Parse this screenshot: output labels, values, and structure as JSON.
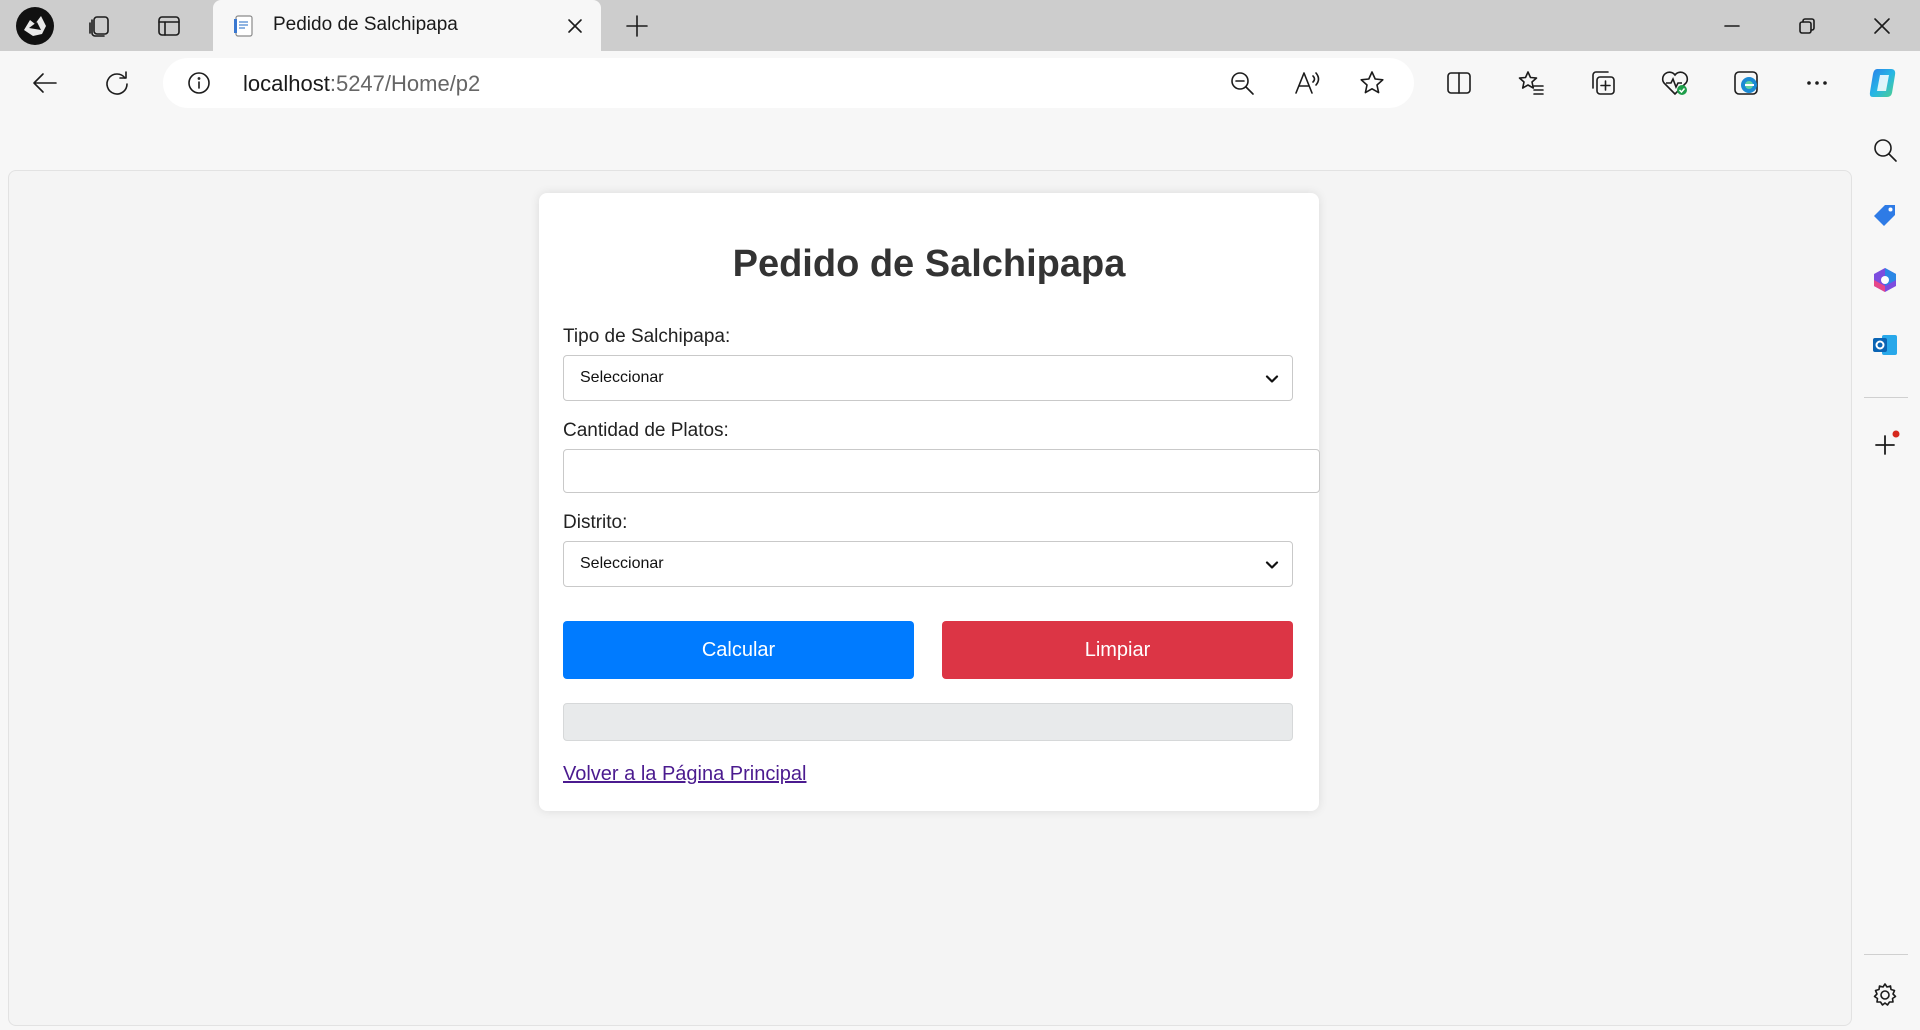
{
  "browser": {
    "tab": {
      "title": "Pedido de Salchipapa"
    },
    "address": {
      "host": "localhost",
      "path": ":5247/Home/p2"
    }
  },
  "page": {
    "title": "Pedido de Salchipapa",
    "tipo_label": "Tipo de Salchipapa:",
    "tipo_value": "Seleccionar",
    "cantidad_label": "Cantidad de Platos:",
    "cantidad_value": "",
    "distrito_label": "Distrito:",
    "distrito_value": "Seleccionar",
    "calc_label": "Calcular",
    "clear_label": "Limpiar",
    "result_value": "",
    "back_link": "Volver a la Página Principal"
  },
  "colors": {
    "primary_button": "#007bff",
    "danger_button": "#dc3545",
    "visited_link": "#4b1b8f"
  }
}
